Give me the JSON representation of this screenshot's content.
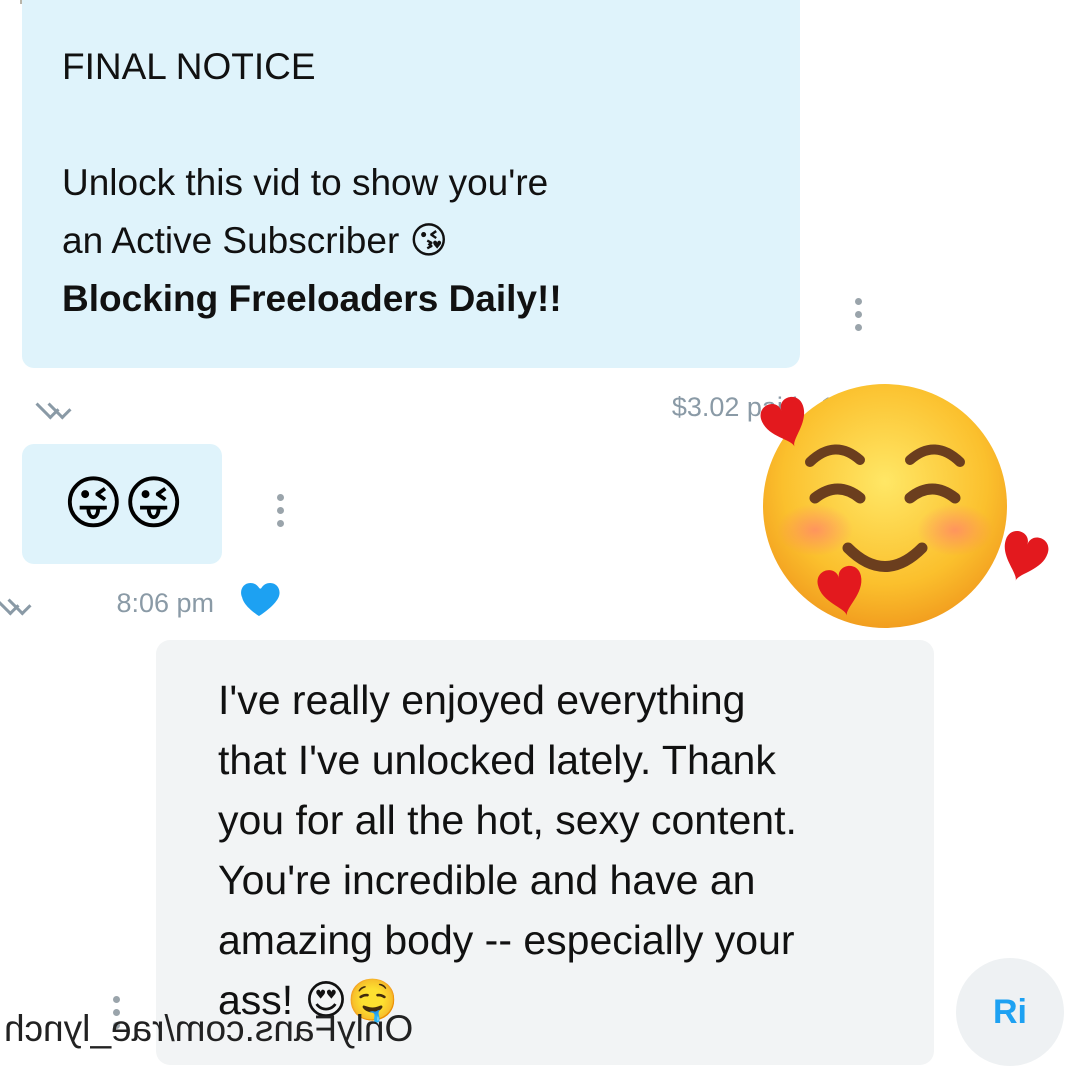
{
  "message_1": {
    "lines": [
      "FINAL NOTICE",
      "",
      "Unlock this vid to show you're",
      "an Active Subscriber 😘",
      "Blocking Freeloaders Daily!!"
    ],
    "price_time": "$3.02 paid , 1:37 pm"
  },
  "message_2": {
    "emojis": "😜😜",
    "time": "8:06 pm"
  },
  "message_3": {
    "lines": [
      "I've really enjoyed everything",
      "that I've unlocked lately. Thank",
      "you for all the hot, sexy content.",
      "You're incredible and have an",
      "amazing body -- especially your",
      "ass! 😍🤤"
    ]
  },
  "avatar": {
    "initials": "Ri"
  },
  "sticker": {
    "icon": "smiling-face-with-hearts-icon"
  },
  "reaction": {
    "icon": "heart-icon",
    "color": "#1da1f2"
  },
  "watermark": {
    "text": "OnlyFans.com/rae_lynch"
  },
  "colors": {
    "bubble_blue": "#dff3fb",
    "bubble_grey": "#f2f4f5",
    "meta": "#8a9aa6",
    "accent": "#1da1f2"
  }
}
